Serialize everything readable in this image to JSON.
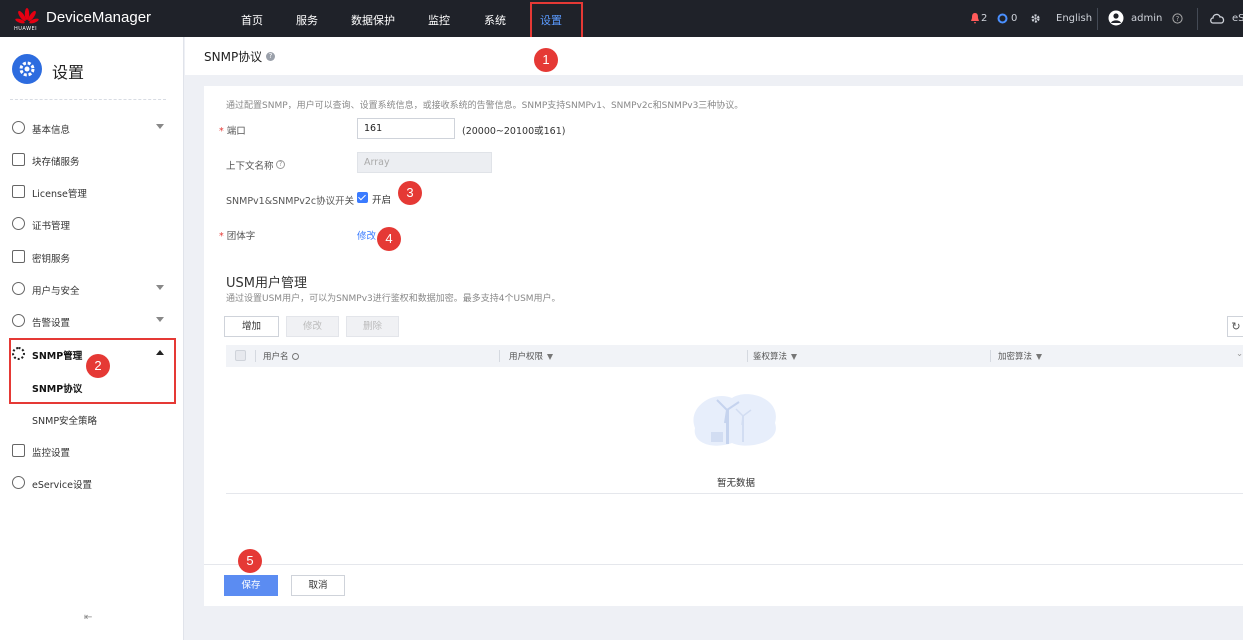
{
  "header": {
    "logo_text": "HUAWEI",
    "brand": "DeviceManager",
    "nav": [
      "首页",
      "服务",
      "数据保护",
      "监控",
      "系统",
      "设置"
    ],
    "alarm_count": "2",
    "task_count": "0",
    "language": "English",
    "user": "admin",
    "cloud_text": "eS"
  },
  "sidebar": {
    "title": "设置",
    "items": [
      {
        "label": "基本信息"
      },
      {
        "label": "块存储服务"
      },
      {
        "label": "License管理"
      },
      {
        "label": "证书管理"
      },
      {
        "label": "密钥服务"
      },
      {
        "label": "用户与安全"
      },
      {
        "label": "告警设置"
      },
      {
        "label": "SNMP管理"
      },
      {
        "label": "监控设置"
      },
      {
        "label": "eService设置"
      }
    ],
    "sub_items": [
      "SNMP协议",
      "SNMP安全策略"
    ]
  },
  "page": {
    "title": "SNMP协议",
    "description": "通过配置SNMP，用户可以查询、设置系统信息，或接收系统的告警信息。SNMP支持SNMPv1、SNMPv2c和SNMPv3三种协议。",
    "port_label": "端口",
    "port_value": "161",
    "port_range": "(20000~20100或161)",
    "context_label": "上下文名称",
    "context_placeholder": "Array",
    "switch_label": "SNMPv1&SNMPv2c协议开关",
    "switch_text": "开启",
    "community_label": "团体字",
    "community_link": "修改"
  },
  "usm": {
    "title": "USM用户管理",
    "description": "通过设置USM用户，可以为SNMPv3进行鉴权和数据加密。最多支持4个USM用户。",
    "buttons": {
      "add": "增加",
      "modify": "修改",
      "delete": "删除"
    },
    "columns": [
      "用户名",
      "用户权限",
      "鉴权算法",
      "加密算法"
    ],
    "empty_text": "暂无数据"
  },
  "footer": {
    "save": "保存",
    "cancel": "取消"
  },
  "badges": [
    "1",
    "2",
    "3",
    "4",
    "5"
  ],
  "colors": {
    "topbar": "#1f2229",
    "accent": "#3a7bff",
    "highlight": "#e53935",
    "primary_button": "#5b8cf2"
  }
}
